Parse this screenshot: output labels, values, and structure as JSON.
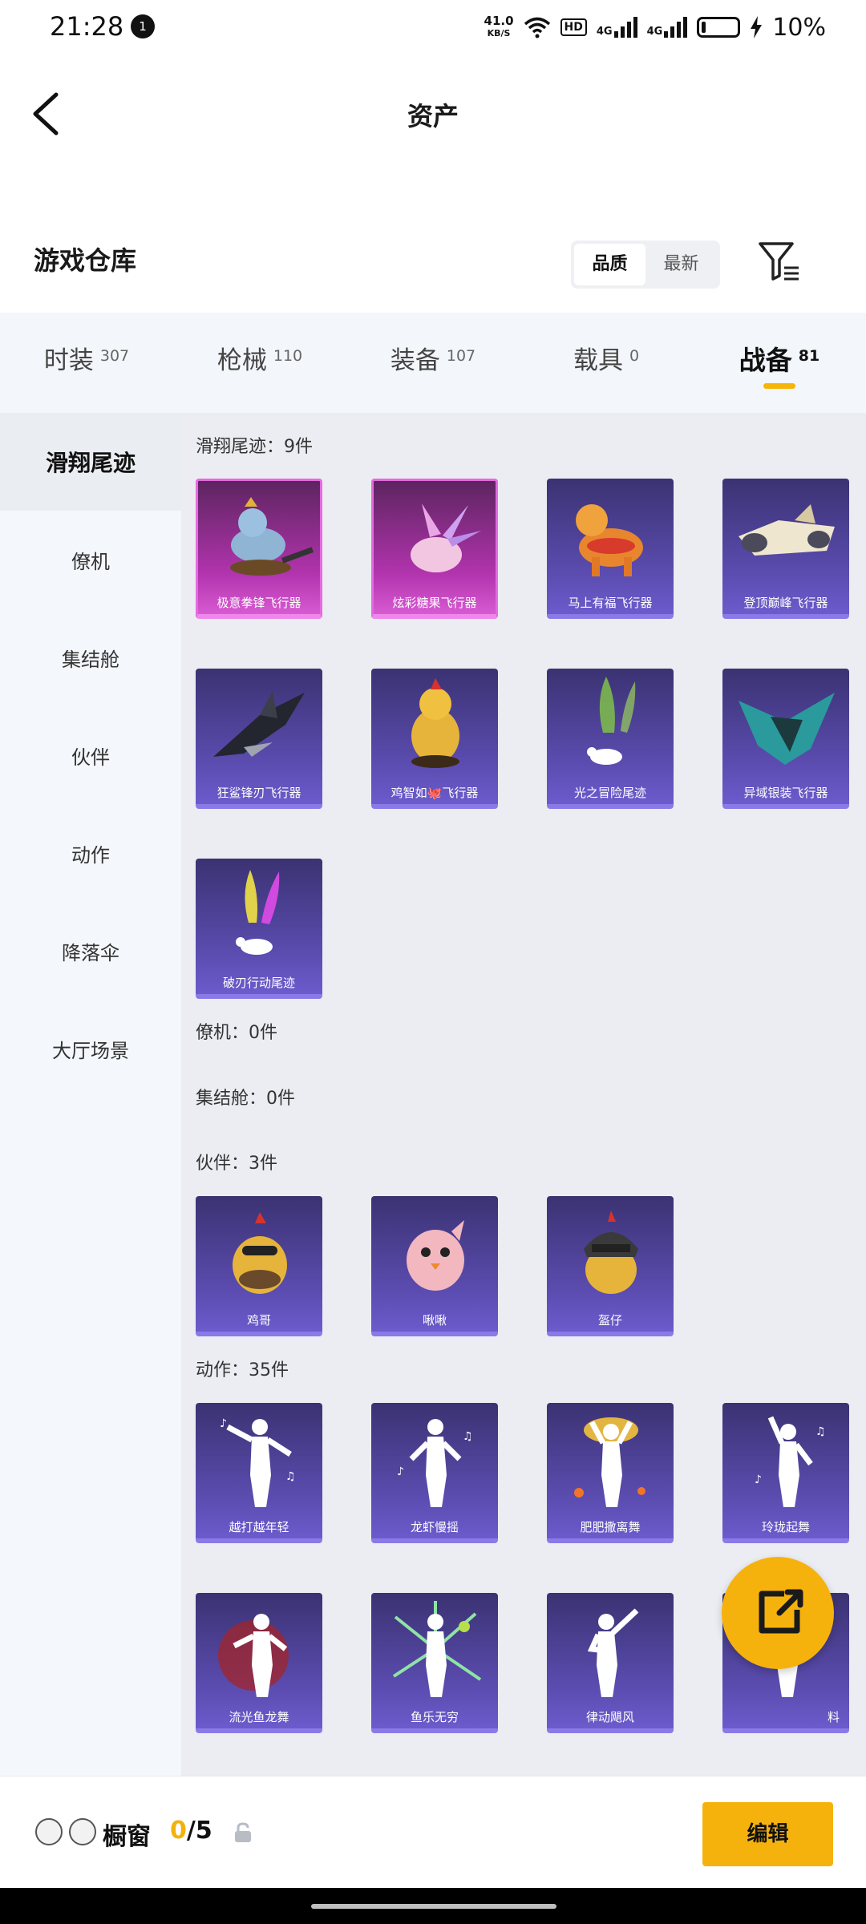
{
  "status_bar": {
    "time": "21:28",
    "notification_count": "1",
    "net_speed_value": "41.0",
    "net_speed_unit": "KB/S",
    "hd_label": "HD",
    "net1": "4G",
    "net2": "4G",
    "battery": "10%"
  },
  "header": {
    "title": "资产"
  },
  "section": {
    "title": "游戏仓库"
  },
  "sort": {
    "quality": "品质",
    "latest": "最新"
  },
  "tabs": [
    {
      "label": "时装",
      "count": "307"
    },
    {
      "label": "枪械",
      "count": "110"
    },
    {
      "label": "装备",
      "count": "107"
    },
    {
      "label": "载具",
      "count": "0"
    },
    {
      "label": "战备",
      "count": "81"
    }
  ],
  "sidenav": [
    "滑翔尾迹",
    "僚机",
    "集结舱",
    "伙伴",
    "动作",
    "降落伞",
    "大厅场景"
  ],
  "groups": {
    "trail_title": "滑翔尾迹：9件",
    "wingman_title": "僚机：0件",
    "pod_title": "集结舱：0件",
    "partner_title": "伙伴：3件",
    "action_title": "动作：35件"
  },
  "trail_items": [
    "极意拳锋飞行器",
    "炫彩糖果飞行器",
    "马上有福飞行器",
    "登顶巅峰飞行器",
    "狂鲨锋刃飞行器",
    "鸡智如🐙飞行器",
    "光之冒险尾迹",
    "异域银装飞行器",
    "破刃行动尾迹"
  ],
  "partner_items": [
    "鸡哥",
    "啾啾",
    "盔仔"
  ],
  "action_items": [
    "越打越年轻",
    "龙虾慢摇",
    "肥肥撒离舞",
    "玲珑起舞",
    "流光鱼龙舞",
    "鱼乐无穷",
    "律动飓风",
    "料"
  ],
  "bottom": {
    "label": "橱窗",
    "count_current": "0",
    "count_total": "/5",
    "edit": "编辑"
  },
  "colors": {
    "accent": "#f6b20c",
    "card_purple": "#5b4cb0",
    "card_pink": "#b234ae"
  },
  "icons": [
    "back-icon",
    "filter-icon",
    "share-icon",
    "lock-icon"
  ]
}
